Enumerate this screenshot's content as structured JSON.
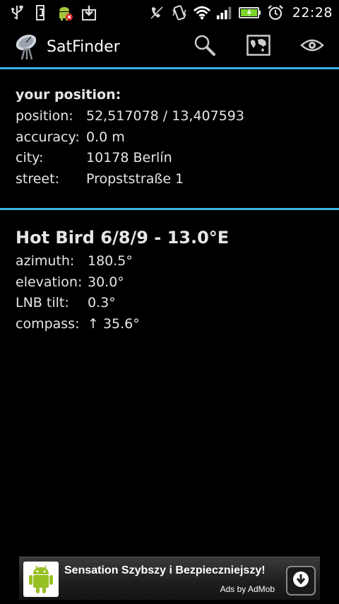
{
  "status_bar": {
    "time": "22:28",
    "icons_left": [
      "usb-icon",
      "usb-debug-icon",
      "android-alert-icon",
      "download-icon"
    ],
    "icons_right": [
      "silent-icon",
      "vibrate-icon",
      "wifi-icon",
      "signal-icon",
      "battery-icon",
      "alarm-icon"
    ]
  },
  "action_bar": {
    "title": "SatFinder",
    "actions": [
      "search-icon",
      "map-icon",
      "eye-icon"
    ]
  },
  "position": {
    "heading": "your position:",
    "rows": [
      {
        "label": "position:",
        "value": "52,517078 / 13,407593"
      },
      {
        "label": "accuracy:",
        "value": "0.0 m"
      },
      {
        "label": "city:",
        "value": "10178 Berlín"
      },
      {
        "label": "street:",
        "value": "Propststraße 1"
      }
    ]
  },
  "satellite": {
    "name": "Hot Bird 6/8/9 - 13.0°E",
    "rows": [
      {
        "label": "azimuth:",
        "value": "180.5°"
      },
      {
        "label": "elevation:",
        "value": "30.0°"
      },
      {
        "label": "LNB tilt:",
        "value": "0.3°"
      },
      {
        "label": "compass:",
        "value": "↑ 35.6°"
      }
    ]
  },
  "ad": {
    "text": "Sensation Szybszy i Bezpieczniejszy!",
    "by": "Ads by AdMob"
  },
  "colors": {
    "accent": "#33b5e5",
    "background": "#000000"
  }
}
